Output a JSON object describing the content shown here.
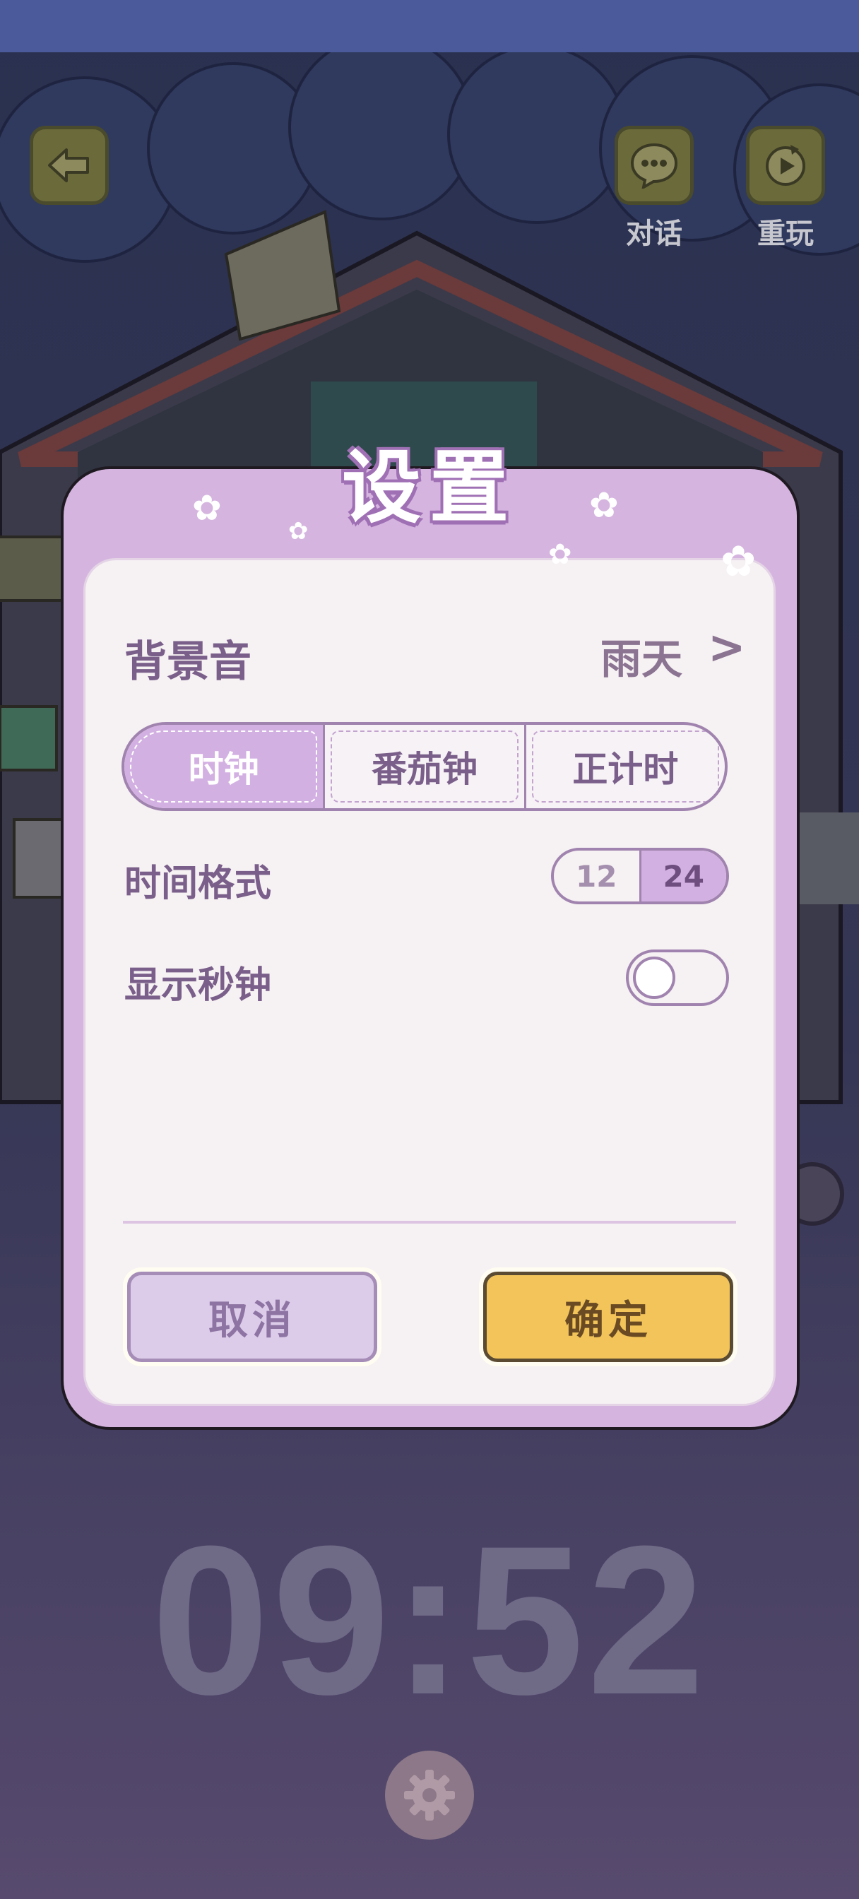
{
  "top_bar": {
    "back_icon": "back-arrow-icon",
    "chat_label": "对话",
    "chat_icon": "chat-bubble-icon",
    "replay_label": "重玩",
    "replay_icon": "replay-icon"
  },
  "background": {
    "clock_time": "09:52",
    "gear_icon": "gear-icon"
  },
  "dialog": {
    "title": "设置",
    "background_sound": {
      "label": "背景音",
      "value": "雨天",
      "chevron": ">"
    },
    "mode_tabs": [
      {
        "label": "时钟",
        "selected": true
      },
      {
        "label": "番茄钟",
        "selected": false
      },
      {
        "label": "正计时",
        "selected": false
      }
    ],
    "time_format": {
      "label": "时间格式",
      "options": [
        "12",
        "24"
      ],
      "selected": "24"
    },
    "show_seconds": {
      "label": "显示秒钟",
      "enabled": false
    },
    "cancel_label": "取消",
    "confirm_label": "确定"
  },
  "colors": {
    "dialog_frame": "#d5b5df",
    "panel_bg": "#f6f1f3",
    "accent_purple": "#a083ae",
    "confirm_yellow": "#f2c45a",
    "cancel_lilac": "#dcccea"
  }
}
